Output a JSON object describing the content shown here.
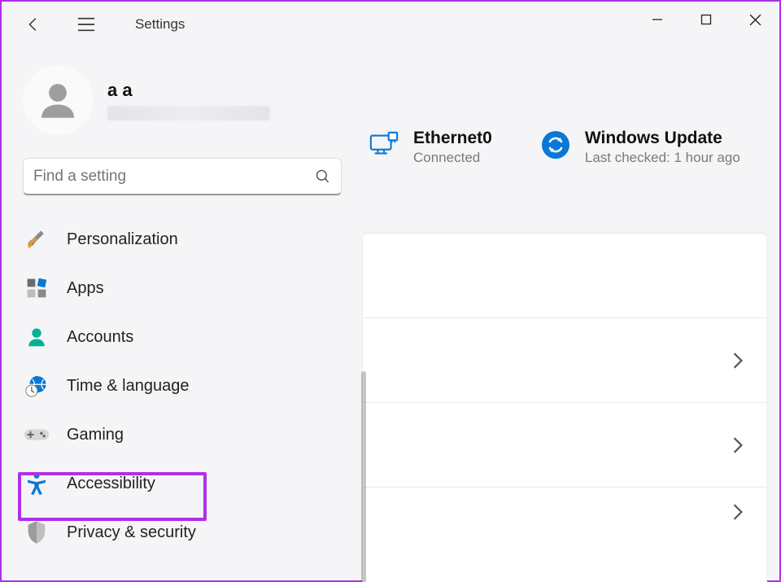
{
  "app": {
    "title": "Settings"
  },
  "window_controls": {
    "minimize": "minimize",
    "maximize": "maximize",
    "close": "close"
  },
  "user": {
    "name": "a a"
  },
  "search": {
    "placeholder": "Find a setting"
  },
  "sidebar": {
    "items": [
      {
        "id": "personalization",
        "label": "Personalization",
        "icon": "brush-icon"
      },
      {
        "id": "apps",
        "label": "Apps",
        "icon": "apps-icon"
      },
      {
        "id": "accounts",
        "label": "Accounts",
        "icon": "person-icon"
      },
      {
        "id": "time-language",
        "label": "Time & language",
        "icon": "clock-globe-icon"
      },
      {
        "id": "gaming",
        "label": "Gaming",
        "icon": "gamepad-icon"
      },
      {
        "id": "accessibility",
        "label": "Accessibility",
        "icon": "accessibility-icon",
        "highlighted": true
      },
      {
        "id": "privacy",
        "label": "Privacy & security",
        "icon": "shield-icon"
      }
    ]
  },
  "status": {
    "network": {
      "title": "Ethernet0",
      "subtitle": "Connected",
      "icon": "pc-network-icon"
    },
    "update": {
      "title": "Windows Update",
      "subtitle": "Last checked: 1 hour ago",
      "icon": "update-sync-icon"
    }
  },
  "colors": {
    "accent_blue": "#0a78d4",
    "teal": "#00b294",
    "highlight": "#b030e8"
  }
}
